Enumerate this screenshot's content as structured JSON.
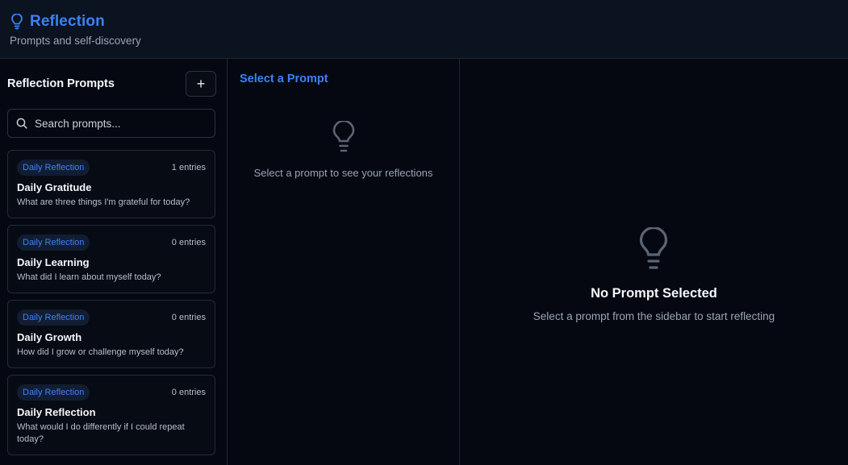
{
  "header": {
    "title": "Reflection",
    "subtitle": "Prompts and self-discovery",
    "icon": "lightbulb-icon",
    "accent_color": "#3b82f6"
  },
  "sidebar": {
    "title": "Reflection Prompts",
    "add_label": "+",
    "search": {
      "placeholder": "Search prompts...",
      "value": ""
    },
    "prompts": [
      {
        "category": "Daily Reflection",
        "entries": "1 entries",
        "title": "Daily Gratitude",
        "question": "What are three things I'm grateful for today?"
      },
      {
        "category": "Daily Reflection",
        "entries": "0 entries",
        "title": "Daily Learning",
        "question": "What did I learn about myself today?"
      },
      {
        "category": "Daily Reflection",
        "entries": "0 entries",
        "title": "Daily Growth",
        "question": "How did I grow or challenge myself today?"
      },
      {
        "category": "Daily Reflection",
        "entries": "0 entries",
        "title": "Daily Reflection",
        "question": "What would I do differently if I could repeat today?"
      }
    ]
  },
  "middle": {
    "title": "Select a Prompt",
    "empty_text": "Select a prompt to see your reflections"
  },
  "main": {
    "empty_title": "No Prompt Selected",
    "empty_text": "Select a prompt from the sidebar to start reflecting"
  }
}
